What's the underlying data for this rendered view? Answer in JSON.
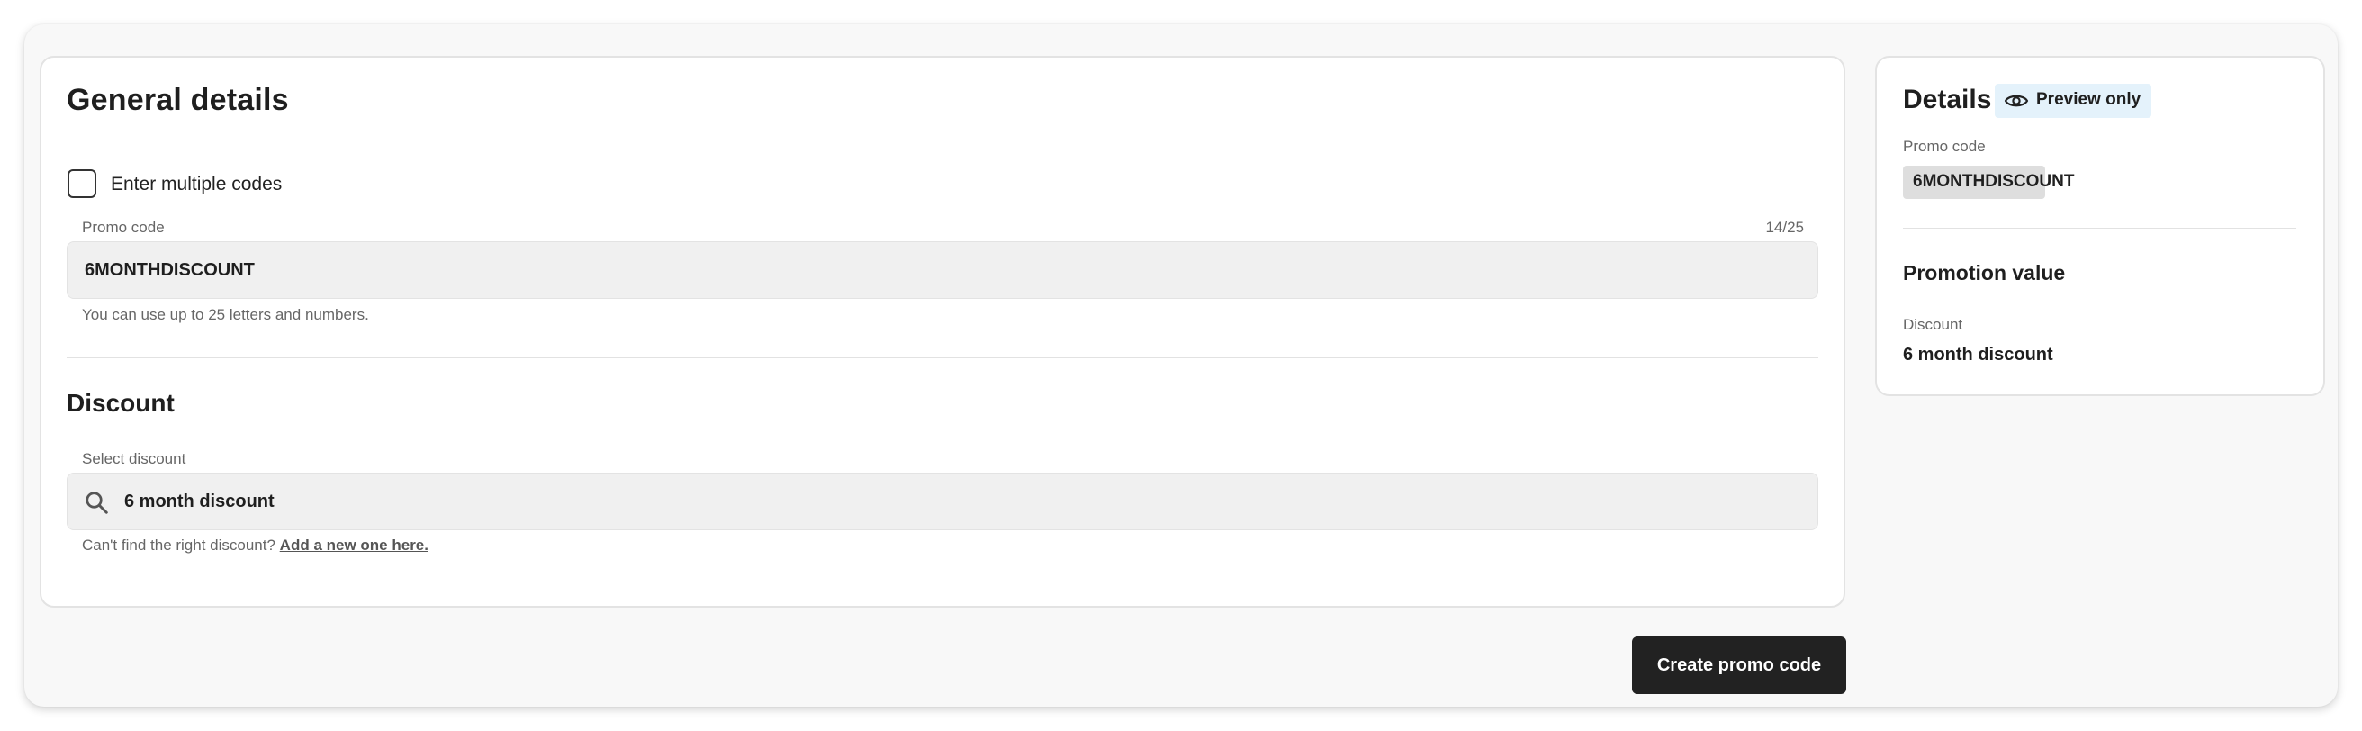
{
  "general": {
    "title": "General details",
    "multiple_codes_label": "Enter multiple codes",
    "multiple_codes_checked": false,
    "promo_label": "Promo code",
    "promo_count": "14/25",
    "promo_value": "6MONTHDISCOUNT",
    "promo_help": "You can use up to 25 letters and numbers."
  },
  "discount": {
    "title": "Discount",
    "select_label": "Select discount",
    "value": "6 month discount",
    "help_prefix": "Can't find the right discount?",
    "help_link": "Add a new one here."
  },
  "actions": {
    "create_label": "Create promo code"
  },
  "details": {
    "title": "Details",
    "badge": "Preview only",
    "promo_label": "Promo code",
    "promo_value": "6MONTHDISCOUNT",
    "promotion_value_title": "Promotion value",
    "discount_label": "Discount",
    "discount_value": "6 month discount"
  },
  "icons": {
    "search": "search-icon",
    "preview": "eye-icon"
  },
  "colors": {
    "primary_button": "#222222",
    "badge_bg": "#e4f2fb",
    "input_bg": "#f0f0f0",
    "chip_bg": "#dedede"
  }
}
